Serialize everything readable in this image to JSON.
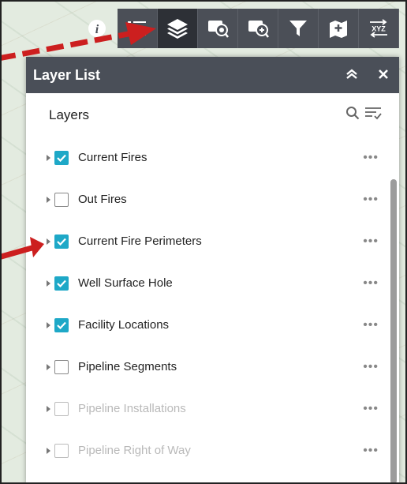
{
  "panel": {
    "title": "Layer List",
    "collapse_icon": "double-chevron-up-icon",
    "close_icon": "close-icon"
  },
  "layers_section": {
    "title": "Layers",
    "search_icon": "search-icon",
    "options_icon": "sort-filter-icon"
  },
  "layers": [
    {
      "label": "Current Fires",
      "checked": true,
      "faded": false
    },
    {
      "label": "Out Fires",
      "checked": false,
      "faded": false
    },
    {
      "label": "Current Fire Perimeters",
      "checked": true,
      "faded": false
    },
    {
      "label": "Well Surface Hole",
      "checked": true,
      "faded": false
    },
    {
      "label": "Facility Locations",
      "checked": true,
      "faded": false
    },
    {
      "label": "Pipeline Segments",
      "checked": false,
      "faded": false
    },
    {
      "label": "Pipeline Installations",
      "checked": false,
      "faded": true
    },
    {
      "label": "Pipeline Right of Way",
      "checked": false,
      "faded": true
    }
  ],
  "more_glyph": "•••",
  "toolbar": [
    {
      "icon": "info-icon"
    },
    {
      "icon": "legend-icon"
    },
    {
      "icon": "layers-icon",
      "active": true
    },
    {
      "icon": "select-icon"
    },
    {
      "icon": "query-icon"
    },
    {
      "icon": "filter-icon"
    },
    {
      "icon": "add-data-icon"
    },
    {
      "icon": "coordinate-conversion-icon",
      "label": "XYZ"
    }
  ],
  "colors": {
    "accent": "#1ea8c7",
    "header": "#4a4f58",
    "annotation_arrow": "#cc1f1f"
  }
}
